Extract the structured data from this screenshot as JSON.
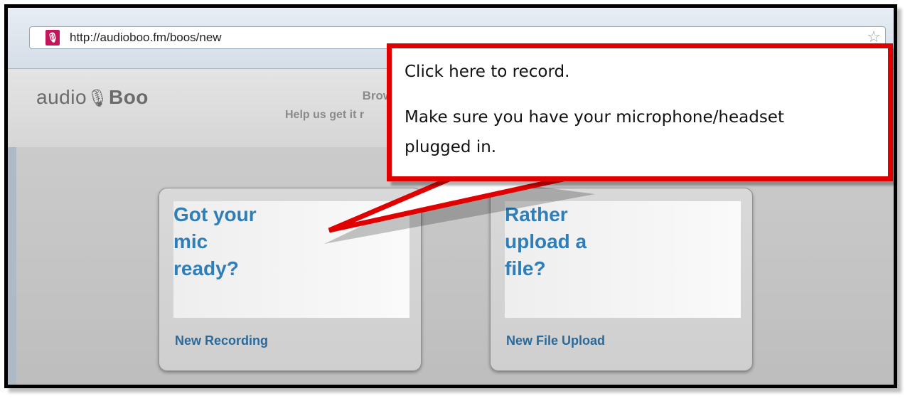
{
  "browser": {
    "url": "http://audioboo.fm/boos/new",
    "favicon": "audioboo-favicon",
    "bookmark_icon": "star-icon"
  },
  "site": {
    "logo_prefix": "audio",
    "logo_mic": "🎙",
    "logo_suffix": "Boo",
    "browse_text": "Browse",
    "help_text": "Help us get it r"
  },
  "cards": [
    {
      "headline": "Got your\nmic\nready?",
      "link": "New Recording"
    },
    {
      "headline": "Rather\nupload a\nfile?",
      "link": "New File Upload"
    }
  ],
  "callout": {
    "line1": "Click here to record.",
    "line2": "Make sure you have your microphone/headset",
    "line3": "plugged in.",
    "border_color": "#e00000"
  }
}
